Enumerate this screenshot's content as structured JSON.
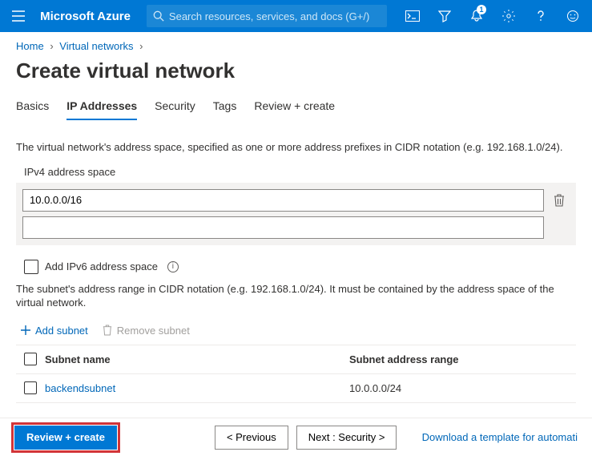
{
  "topbar": {
    "brand": "Microsoft Azure",
    "search_placeholder": "Search resources, services, and docs (G+/)",
    "notification_count": "1"
  },
  "breadcrumbs": {
    "home": "Home",
    "vnets": "Virtual networks"
  },
  "page_title": "Create virtual network",
  "tabs": {
    "basics": "Basics",
    "ip": "IP Addresses",
    "security": "Security",
    "tags": "Tags",
    "review": "Review + create"
  },
  "ip_section": {
    "description": "The virtual network's address space, specified as one or more address prefixes in CIDR notation (e.g. 192.168.1.0/24).",
    "label": "IPv4 address space",
    "addresses": [
      "10.0.0.0/16"
    ],
    "ipv6_label": "Add IPv6 address space"
  },
  "subnet_section": {
    "description": "The subnet's address range in CIDR notation (e.g. 192.168.1.0/24). It must be contained by the address space of the virtual network.",
    "add_label": "Add subnet",
    "remove_label": "Remove subnet",
    "col_name": "Subnet name",
    "col_range": "Subnet address range",
    "rows": [
      {
        "name": "backendsubnet",
        "range": "10.0.0.0/24"
      }
    ]
  },
  "footer": {
    "review": "Review + create",
    "previous": "< Previous",
    "next": "Next : Security >",
    "download": "Download a template for automati"
  }
}
